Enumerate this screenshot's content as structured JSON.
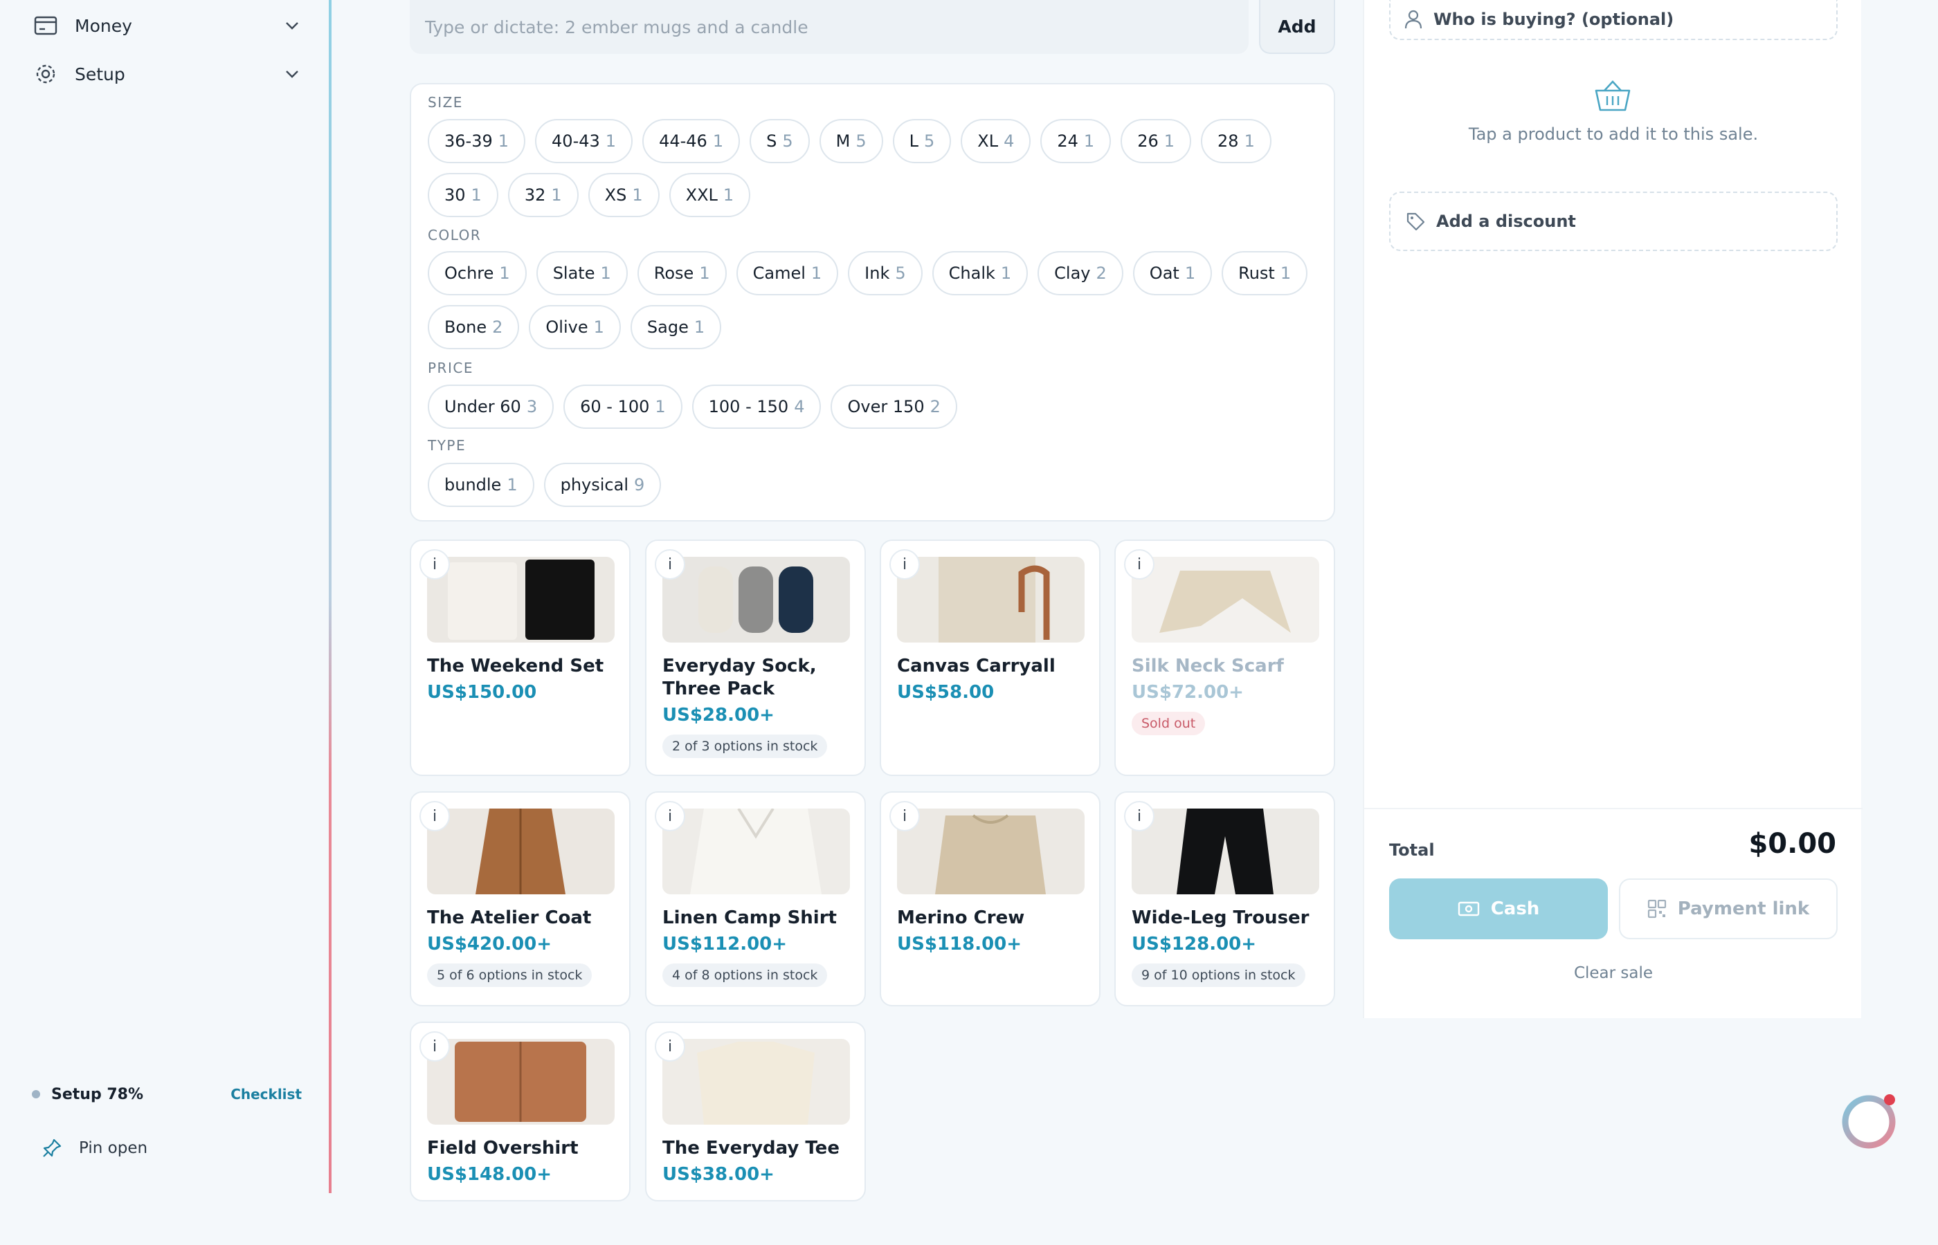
{
  "sidebar": {
    "items": [
      {
        "label": "Money",
        "icon": "credit-card-icon"
      },
      {
        "label": "Setup",
        "icon": "gear-icon"
      }
    ],
    "setup_progress": "Setup 78%",
    "checklist_link": "Checklist",
    "pin_label": "Pin open"
  },
  "add_bar": {
    "placeholder": "Type or dictate: 2 ember mugs and a candle",
    "add_label": "Add"
  },
  "filters": [
    {
      "title": "SIZE",
      "chips": [
        {
          "label": "36-39",
          "count": "1"
        },
        {
          "label": "40-43",
          "count": "1"
        },
        {
          "label": "44-46",
          "count": "1"
        },
        {
          "label": "S",
          "count": "5"
        },
        {
          "label": "M",
          "count": "5"
        },
        {
          "label": "L",
          "count": "5"
        },
        {
          "label": "XL",
          "count": "4"
        },
        {
          "label": "24",
          "count": "1"
        },
        {
          "label": "26",
          "count": "1"
        },
        {
          "label": "28",
          "count": "1"
        },
        {
          "label": "30",
          "count": "1"
        },
        {
          "label": "32",
          "count": "1"
        },
        {
          "label": "XS",
          "count": "1"
        },
        {
          "label": "XXL",
          "count": "1"
        }
      ]
    },
    {
      "title": "COLOR",
      "chips": [
        {
          "label": "Ochre",
          "count": "1"
        },
        {
          "label": "Slate",
          "count": "1"
        },
        {
          "label": "Rose",
          "count": "1"
        },
        {
          "label": "Camel",
          "count": "1"
        },
        {
          "label": "Ink",
          "count": "5"
        },
        {
          "label": "Chalk",
          "count": "1"
        },
        {
          "label": "Clay",
          "count": "2"
        },
        {
          "label": "Oat",
          "count": "1"
        },
        {
          "label": "Rust",
          "count": "1"
        },
        {
          "label": "Bone",
          "count": "2"
        },
        {
          "label": "Olive",
          "count": "1"
        },
        {
          "label": "Sage",
          "count": "1"
        }
      ]
    },
    {
      "title": "PRICE",
      "chips": [
        {
          "label": "Under 60",
          "count": "3"
        },
        {
          "label": "60 - 100",
          "count": "1"
        },
        {
          "label": "100 - 150",
          "count": "4"
        },
        {
          "label": "Over 150",
          "count": "2"
        }
      ]
    },
    {
      "title": "TYPE",
      "chips": [
        {
          "label": "bundle",
          "count": "1"
        },
        {
          "label": "physical",
          "count": "9"
        }
      ]
    }
  ],
  "products": [
    {
      "name": "The Weekend Set",
      "price": "US$150.00",
      "stock": "",
      "sold_out": ""
    },
    {
      "name": "Everyday Sock, Three Pack",
      "price": "US$28.00+",
      "stock": "2 of 3 options in stock",
      "sold_out": ""
    },
    {
      "name": "Canvas Carryall",
      "price": "US$58.00",
      "stock": "",
      "sold_out": ""
    },
    {
      "name": "Silk Neck Scarf",
      "price": "US$72.00+",
      "stock": "",
      "sold_out": "Sold out"
    },
    {
      "name": "The Atelier Coat",
      "price": "US$420.00+",
      "stock": "5 of 6 options in stock",
      "sold_out": ""
    },
    {
      "name": "Linen Camp Shirt",
      "price": "US$112.00+",
      "stock": "4 of 8 options in stock",
      "sold_out": ""
    },
    {
      "name": "Merino Crew",
      "price": "US$118.00+",
      "stock": "",
      "sold_out": ""
    },
    {
      "name": "Wide-Leg Trouser",
      "price": "US$128.00+",
      "stock": "9 of 10 options in stock",
      "sold_out": ""
    },
    {
      "name": "Field Overshirt",
      "price": "US$148.00+",
      "stock": "",
      "sold_out": ""
    },
    {
      "name": "The Everyday Tee",
      "price": "US$38.00+",
      "stock": "",
      "sold_out": ""
    }
  ],
  "info_label": "i",
  "sale": {
    "buyer_label": "Who is buying? (optional)",
    "empty_text": "Tap a product to add it to this sale.",
    "discount_label": "Add a discount",
    "total_label": "Total",
    "total_value": "$0.00",
    "cash_label": "Cash",
    "payment_link_label": "Payment link",
    "clear_label": "Clear sale"
  },
  "colors": {
    "accent": "#1a8fb4",
    "cash_button": "#9ad2e1",
    "sold_out": "#c85a68"
  }
}
